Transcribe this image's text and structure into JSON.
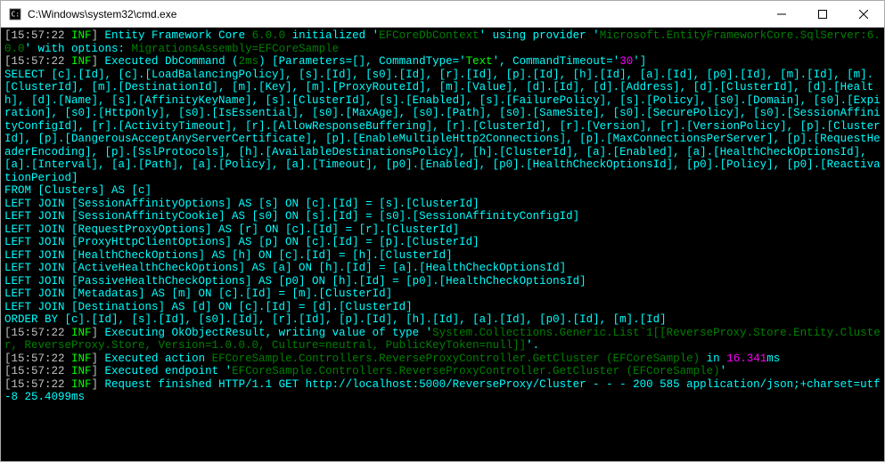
{
  "window": {
    "title": "C:\\Windows\\system32\\cmd.exe"
  },
  "log": {
    "l1_ts": "[15:57:22 ",
    "l1_inf": "INF",
    "l1_ts2": "] ",
    "l1_body": "Entity Framework Core ",
    "l1_ver": "6.0.0",
    "l1_body2": " initialized '",
    "l1_ctx": "EFCoreDbContext",
    "l1_body3": "' using provider '",
    "l1_prov": "Microsoft.EntityFrameworkCore.SqlServer:6.0.0",
    "l1_body4": "' with options: ",
    "l1_opts": "MigrationsAssembly=EFCoreSample ",
    "l2_ts": "[15:57:22 ",
    "l2_inf": "INF",
    "l2_ts2": "] ",
    "l2_body": "Executed DbCommand (",
    "l2_ms": "2ms",
    "l2_body2": ") [Parameters=[",
    "l2_params": "",
    "l2_body3": "], CommandType='",
    "l2_ct": "Text",
    "l2_body4": "', CommandTimeout='",
    "l2_cto": "30",
    "l2_body5": "']",
    "sql": "SELECT [c].[Id], [c].[LoadBalancingPolicy], [s].[Id], [s0].[Id], [r].[Id], [p].[Id], [h].[Id], [a].[Id], [p0].[Id], [m].[Id], [m].[ClusterId], [m].[DestinationId], [m].[Key], [m].[ProxyRouteId], [m].[Value], [d].[Id], [d].[Address], [d].[ClusterId], [d].[Health], [d].[Name], [s].[AffinityKeyName], [s].[ClusterId], [s].[Enabled], [s].[FailurePolicy], [s].[Policy], [s0].[Domain], [s0].[Expiration], [s0].[HttpOnly], [s0].[IsEssential], [s0].[MaxAge], [s0].[Path], [s0].[SameSite], [s0].[SecurePolicy], [s0].[SessionAffinityConfigId], [r].[ActivityTimeout], [r].[AllowResponseBuffering], [r].[ClusterId], [r].[Version], [r].[VersionPolicy], [p].[ClusterId], [p].[DangerousAcceptAnyServerCertificate], [p].[EnableMultipleHttp2Connections], [p].[MaxConnectionsPerServer], [p].[RequestHeaderEncoding], [p].[SslProtocols], [h].[AvailableDestinationsPolicy], [h].[ClusterId], [a].[Enabled], [a].[HealthCheckOptionsId], [a].[Interval], [a].[Path], [a].[Policy], [a].[Timeout], [p0].[Enabled], [p0].[HealthCheckOptionsId], [p0].[Policy], [p0].[ReactivationPeriod]\nFROM [Clusters] AS [c]\nLEFT JOIN [SessionAffinityOptions] AS [s] ON [c].[Id] = [s].[ClusterId]\nLEFT JOIN [SessionAffinityCookie] AS [s0] ON [s].[Id] = [s0].[SessionAffinityConfigId]\nLEFT JOIN [RequestProxyOptions] AS [r] ON [c].[Id] = [r].[ClusterId]\nLEFT JOIN [ProxyHttpClientOptions] AS [p] ON [c].[Id] = [p].[ClusterId]\nLEFT JOIN [HealthCheckOptions] AS [h] ON [c].[Id] = [h].[ClusterId]\nLEFT JOIN [ActiveHealthCheckOptions] AS [a] ON [h].[Id] = [a].[HealthCheckOptionsId]\nLEFT JOIN [PassiveHealthCheckOptions] AS [p0] ON [h].[Id] = [p0].[HealthCheckOptionsId]\nLEFT JOIN [Metadatas] AS [m] ON [c].[Id] = [m].[ClusterId]\nLEFT JOIN [Destinations] AS [d] ON [c].[Id] = [d].[ClusterId]\nORDER BY [c].[Id], [s].[Id], [s0].[Id], [r].[Id], [p].[Id], [h].[Id], [a].[Id], [p0].[Id], [m].[Id]",
    "l3_ts": "[15:57:22 ",
    "l3_inf": "INF",
    "l3_ts2": "] ",
    "l3_body": "Executing OkObjectResult, writing value of type '",
    "l3_type": "System.Collections.Generic.List`1[[ReverseProxy.Store.Entity.Cluster, ReverseProxy.Store, Version=1.0.0.0, Culture=neutral, PublicKeyToken=null]]",
    "l3_body2": "'.",
    "l4_ts": "[15:57:22 ",
    "l4_inf": "INF",
    "l4_ts2": "] ",
    "l4_body": "Executed action ",
    "l4_act": "EFCoreSample.Controllers.ReverseProxyController.GetCluster (EFCoreSample)",
    "l4_body2": " in ",
    "l4_time": "16.341",
    "l4_body3": "ms",
    "l5_ts": "[15:57:22 ",
    "l5_inf": "INF",
    "l5_ts2": "] ",
    "l5_body": "Executed endpoint '",
    "l5_ep": "EFCoreSample.Controllers.ReverseProxyController.GetCluster (EFCoreSample)",
    "l5_body2": "'",
    "l6_ts": "[15:57:22 ",
    "l6_inf": "INF",
    "l6_ts2": "] ",
    "l6_body": "Request finished HTTP/1.1 GET http://localhost:5000/ReverseProxy/Cluster - - - 200 585 application/json;+charset=utf-8 25.4099ms"
  }
}
